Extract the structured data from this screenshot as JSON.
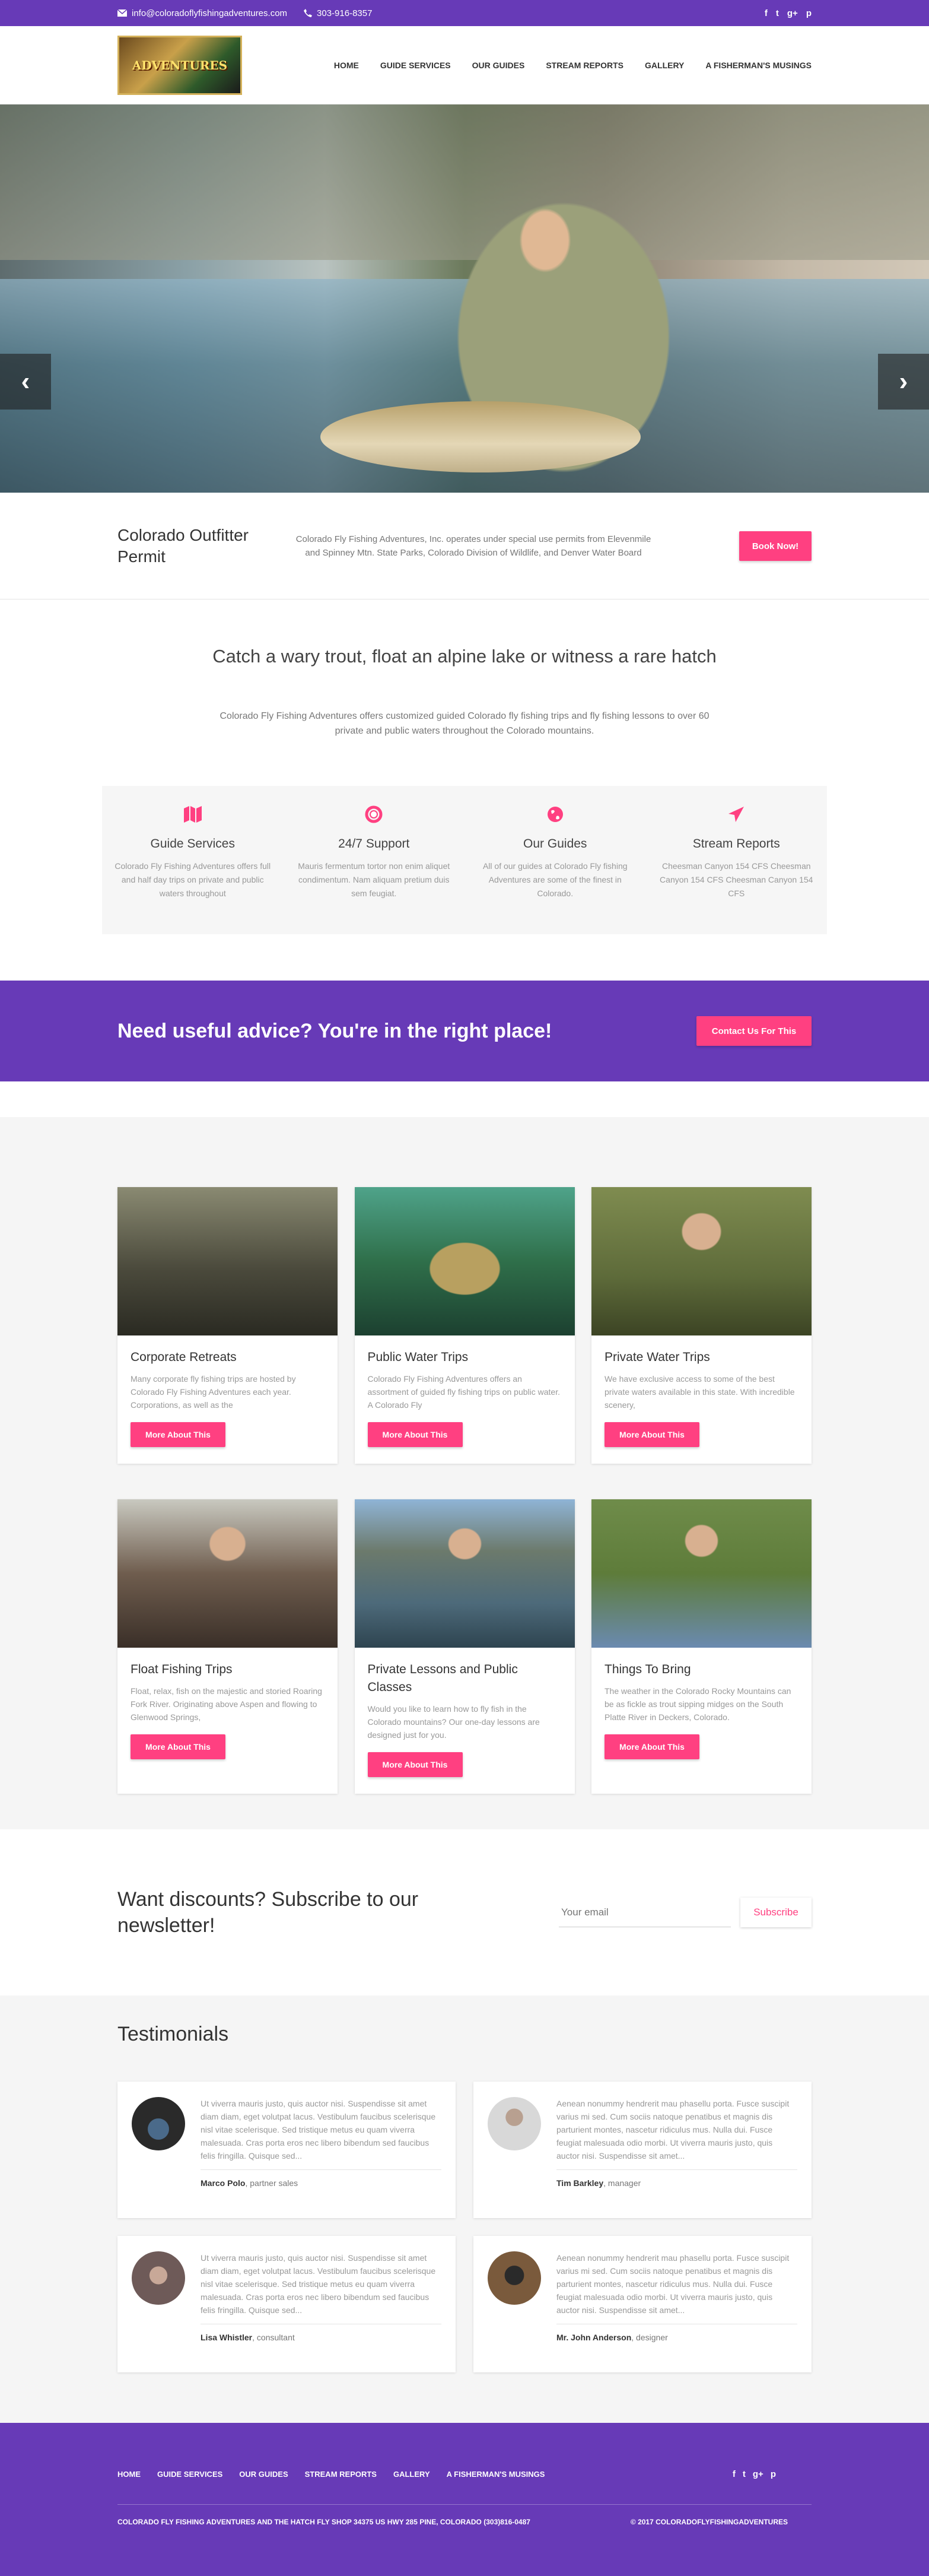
{
  "topbar": {
    "email": "info@coloradoflyfishingadventures.com",
    "phone": "303-916-8357",
    "social": [
      "f",
      "t",
      "g+",
      "p"
    ]
  },
  "header": {
    "logo_text": "ADVENTURES",
    "nav": [
      "HOME",
      "GUIDE SERVICES",
      "OUR GUIDES",
      "STREAM REPORTS",
      "GALLERY",
      "A FISHERMAN'S MUSINGS"
    ]
  },
  "hero": {
    "prev": "‹",
    "next": "›"
  },
  "permit": {
    "title": "Colorado Outfitter Permit",
    "text": "Colorado Fly Fishing Adventures, Inc. operates under special use permits from Elevenmile and Spinney Mtn. State Parks, Colorado Division of Wildlife, and Denver Water Board",
    "button": "Book Now!"
  },
  "intro": {
    "title": "Catch a wary trout, float an alpine lake or witness a rare hatch",
    "text": "Colorado Fly Fishing Adventures offers customized guided Colorado fly fishing trips and fly fishing lessons to over 60 private and public waters throughout the Colorado mountains."
  },
  "features": [
    {
      "icon": "map-icon",
      "title": "Guide Services",
      "text": "Colorado Fly Fishing Adventures offers full and half day trips on private and public waters throughout"
    },
    {
      "icon": "support-icon",
      "title": "24/7 Support",
      "text": "Mauris fermentum tortor non enim aliquet condimentum. Nam aliquam pretium duis sem feugiat."
    },
    {
      "icon": "globe-icon",
      "title": "Our Guides",
      "text": "All of our guides at Colorado Fly fishing Adventures are some of the finest in Colorado."
    },
    {
      "icon": "plane-icon",
      "title": "Stream Reports",
      "text": "Cheesman Canyon 154 CFS Cheesman Canyon 154 CFS Cheesman Canyon 154 CFS"
    }
  ],
  "cta": {
    "title": "Need useful advice? You're in the right place!",
    "button": "Contact Us For This"
  },
  "services": [
    {
      "title": "Corporate Retreats",
      "text": "Many corporate fly fishing trips are hosted by Colorado Fly Fishing Adventures each year. Corporations, as well as the",
      "button": "More About This",
      "color": "#4b4a3c"
    },
    {
      "title": "Public Water Trips",
      "text": "Colorado Fly Fishing Adventures offers an assortment of guided fly fishing trips on public water. A Colorado Fly",
      "button": "More About This",
      "color": "#2f6f4a"
    },
    {
      "title": "Private Water Trips",
      "text": "We have exclusive access to some of the best private waters available in this state. With incredible scenery,",
      "button": "More About This",
      "color": "#5e6b3a"
    },
    {
      "title": "Float Fishing Trips",
      "text": "Float, relax, fish on the majestic and storied Roaring Fork River. Originating above Aspen and flowing to Glenwood Springs,",
      "button": "More About This",
      "color": "#6f5d4e"
    },
    {
      "title": "Private Lessons and Public Classes",
      "text": "Would you like to learn how to fly fish in the Colorado mountains? Our one-day lessons are designed just for you.",
      "button": "More About This",
      "color": "#4d6a7a"
    },
    {
      "title": "Things To Bring",
      "text": "The weather in the Colorado Rocky Mountains can be as fickle as trout sipping midges on the South Platte River in Deckers, Colorado.",
      "button": "More About This",
      "color": "#5e7c3a"
    }
  ],
  "newsletter": {
    "title": "Want discounts? Subscribe to our newsletter!",
    "placeholder": "Your email",
    "button": "Subscribe"
  },
  "testimonials": {
    "title": "Testimonials",
    "items": [
      {
        "text": "Ut viverra mauris justo, quis auctor nisi. Suspendisse sit amet diam diam, eget volutpat lacus. Vestibulum faucibus scelerisque nisl vitae scelerisque. Sed tristique metus eu quam viverra malesuada. Cras porta eros nec libero bibendum sed faucibus felis fringilla. Quisque sed...",
        "name": "Marco Polo",
        "role": ", partner sales",
        "color": "#2a2a2a"
      },
      {
        "text": "Aenean nonummy hendrerit mau phasellu porta. Fusce suscipit varius mi sed. Cum sociis natoque penatibus et magnis dis parturient montes, nascetur ridiculus mus. Nulla dui. Fusce feugiat malesuada odio morbi. Ut viverra mauris justo, quis auctor nisi. Suspendisse sit amet...",
        "name": "Tim Barkley",
        "role": ", manager",
        "color": "#c8c8c8"
      },
      {
        "text": "Ut viverra mauris justo, quis auctor nisi. Suspendisse sit amet diam diam, eget volutpat lacus. Vestibulum faucibus scelerisque nisl vitae scelerisque. Sed tristique metus eu quam viverra malesuada. Cras porta eros nec libero bibendum sed faucibus felis fringilla. Quisque sed...",
        "name": "Lisa Whistler",
        "role": ", consultant",
        "color": "#6e5a58"
      },
      {
        "text": "Aenean nonummy hendrerit mau phasellu porta. Fusce suscipit varius mi sed. Cum sociis natoque penatibus et magnis dis parturient montes, nascetur ridiculus mus. Nulla dui. Fusce feugiat malesuada odio morbi. Ut viverra mauris justo, quis auctor nisi. Suspendisse sit amet...",
        "name": "Mr. John Anderson",
        "role": ", designer",
        "color": "#7a5a3c"
      }
    ]
  },
  "footer": {
    "nav": [
      "HOME",
      "GUIDE SERVICES",
      "OUR GUIDES",
      "STREAM REPORTS",
      "GALLERY",
      "A FISHERMAN'S MUSINGS"
    ],
    "social": [
      "f",
      "t",
      "g+",
      "p"
    ],
    "address": "COLORADO FLY FISHING ADVENTURES AND THE HATCH FLY SHOP 34375 US HWY 285 PINE, COLORADO (303)816-0487",
    "copyright": "© 2017 COLORADOFLYFISHINGADVENTURES"
  },
  "colors": {
    "brand": "#673ab7",
    "accent": "#ff4081"
  }
}
